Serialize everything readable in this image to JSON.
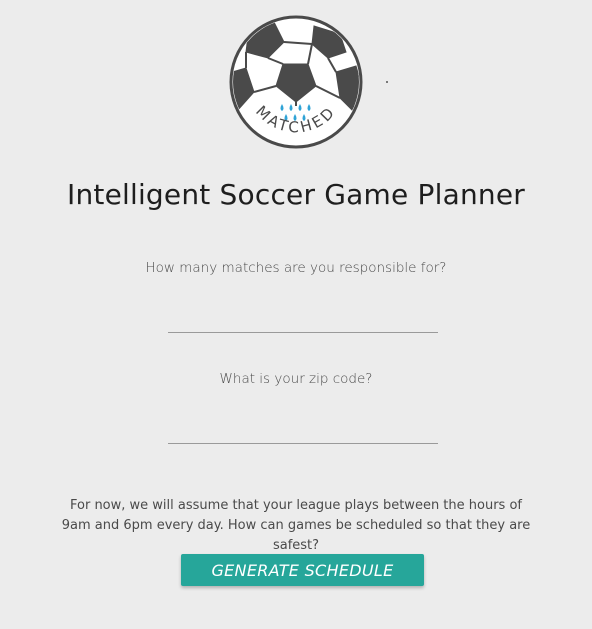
{
  "logo": {
    "text": "MATCHED",
    "accent_color": "#2fa3d6"
  },
  "page": {
    "title": "Intelligent Soccer Game Planner"
  },
  "form": {
    "q1_label": "How many matches are you responsible for?",
    "q1_value": "",
    "q2_label": "What is your zip code?",
    "q2_value": "",
    "note": "For now, we will assume that your league plays between the hours of 9am and 6pm every day. How can games be scheduled so that they are safest?",
    "button_label": "GENERATE SCHEDULE"
  },
  "colors": {
    "background": "#ececec",
    "button": "#26a69a",
    "ball": "#4a4a4a"
  }
}
